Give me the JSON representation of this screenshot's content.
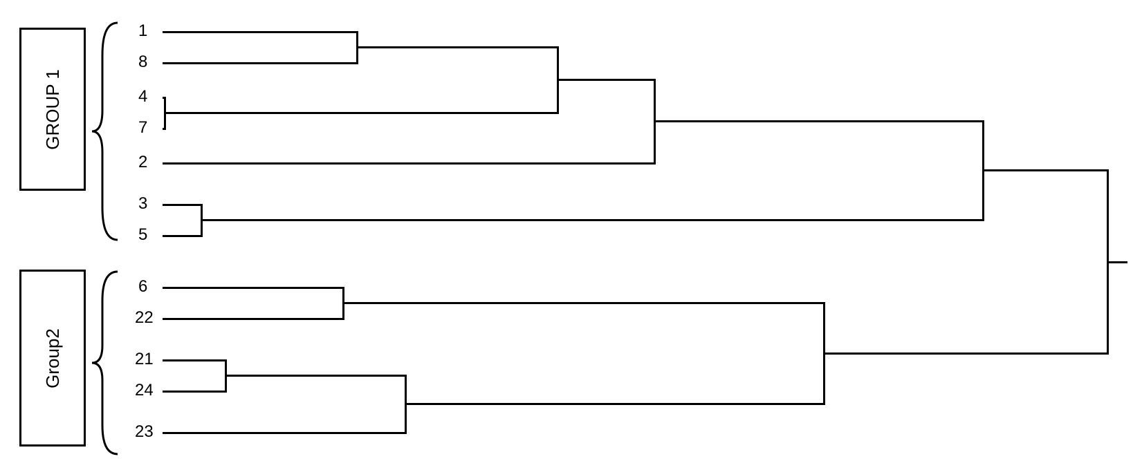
{
  "groups": [
    {
      "label": "GROUP 1"
    },
    {
      "label": "Group2"
    }
  ],
  "leaves": {
    "l1": "1",
    "l8": "8",
    "l4": "4",
    "l7": "7",
    "l2": "2",
    "l3": "3",
    "l5": "5",
    "l6": "6",
    "l22": "22",
    "l21": "21",
    "l24": "24",
    "l23": "23"
  },
  "chart_data": {
    "type": "dendrogram",
    "groups": [
      {
        "name": "GROUP 1",
        "members": [
          "1",
          "8",
          "4",
          "7",
          "2",
          "3",
          "5"
        ]
      },
      {
        "name": "Group2",
        "members": [
          "6",
          "22",
          "21",
          "24",
          "23"
        ]
      }
    ],
    "leaf_order_top_to_bottom": [
      "1",
      "8",
      "4",
      "7",
      "2",
      "3",
      "5",
      "6",
      "22",
      "21",
      "24",
      "23"
    ],
    "merges": [
      {
        "id": "A",
        "children_leaves": [
          "1",
          "8"
        ],
        "height": 0.25
      },
      {
        "id": "B",
        "children_leaves": [
          "4",
          "7"
        ],
        "height": 0.0
      },
      {
        "id": "C",
        "children": [
          "A",
          "B"
        ],
        "height": 0.49
      },
      {
        "id": "D",
        "children": [
          "C",
          "leaf:2"
        ],
        "height": 0.61
      },
      {
        "id": "E",
        "children_leaves": [
          "3",
          "5"
        ],
        "height": 0.05
      },
      {
        "id": "F",
        "children": [
          "D",
          "E"
        ],
        "height": 1.0
      },
      {
        "id": "G",
        "children_leaves": [
          "6",
          "22"
        ],
        "height": 0.23
      },
      {
        "id": "H",
        "children_leaves": [
          "21",
          "24"
        ],
        "height": 0.08
      },
      {
        "id": "I",
        "children": [
          "H",
          "leaf:23"
        ],
        "height": 0.3
      },
      {
        "id": "J",
        "children": [
          "G",
          "I"
        ],
        "height": 0.8
      },
      {
        "id": "K",
        "children": [
          "F",
          "J"
        ],
        "height": 1.15
      }
    ],
    "axis_note": "heights are relative (no numeric axis shown in figure)"
  }
}
